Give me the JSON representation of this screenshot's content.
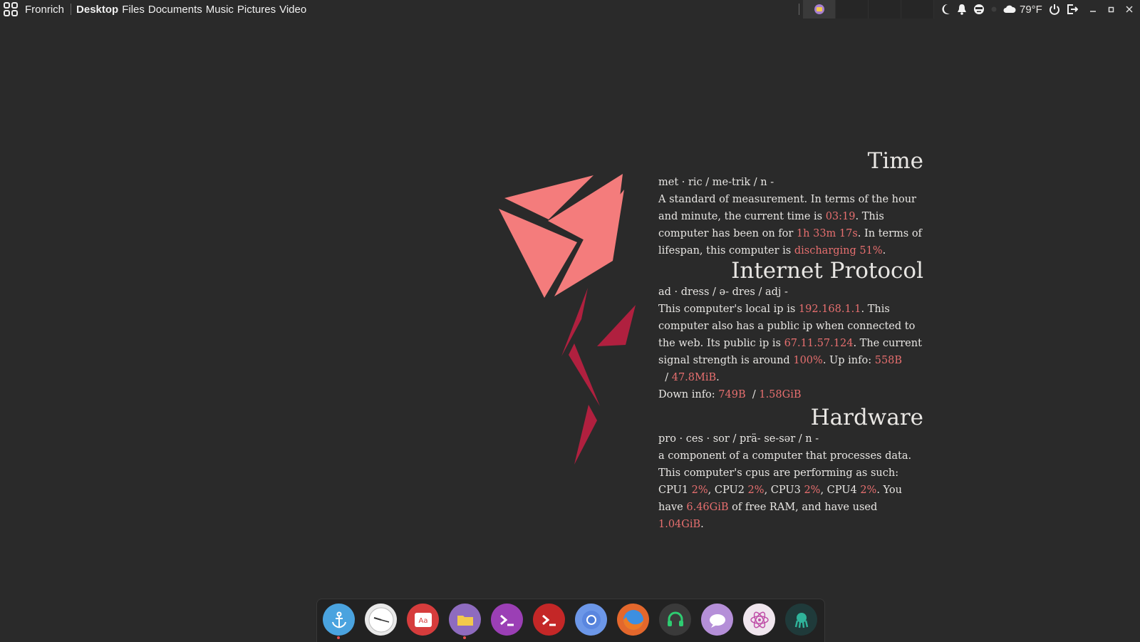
{
  "topbar": {
    "username": "Fronrich",
    "places": [
      "Desktop",
      "Files",
      "Documents",
      "Music",
      "Pictures",
      "Video"
    ],
    "weather": "79°F",
    "tray_icons": [
      "moon-icon",
      "bell-icon",
      "face-icon",
      "cloud-icon",
      "power-icon",
      "logout-icon"
    ],
    "window_controls": [
      "minimize",
      "maximize",
      "close"
    ]
  },
  "sections": {
    "time": {
      "title": "Time",
      "pron": "met · ric /  me-trik / n -",
      "p1": "A standard of measurement. In terms of the hour and minute, the current time is ",
      "time": "03:19",
      "p2": ". This computer has been on for ",
      "uptime": "1h 33m 17s",
      "p3": ". In terms of lifespan, this computer is ",
      "battery": "discharging 51%",
      "p4": "."
    },
    "ip": {
      "title": "Internet Protocol",
      "pron": "ad · dress / ə- dres / adj -",
      "p1": "This computer's local ip is ",
      "local_ip": "192.168.1.1",
      "p2": ". This computer also has a public ip when connected to the web. Its public ip is ",
      "public_ip": "67.11.57.124",
      "p3": ". The current signal strength is around ",
      "signal": "100%",
      "p4": ". Up info: ",
      "up_now": "558B",
      "p5": "  / ",
      "up_total": "47.8MiB",
      "p6": ".",
      "p7": "Down info: ",
      "down_now": "749B",
      "p8": "  / ",
      "down_total": "1.58GiB"
    },
    "hw": {
      "title": "Hardware",
      "pron": "pro · ces · sor /  prä- se-sər / n -",
      "p1": "a component of a computer that processes data. This computer's cpus are performing as such: CPU1 ",
      "cpu1": "2%",
      "p2": ", CPU2 ",
      "cpu2": "2%",
      "p3": ", CPU3 ",
      "cpu3": "2%",
      "p4": ", CPU4 ",
      "cpu4": "2%",
      "p5": ". You have ",
      "free_ram": "6.46GiB",
      "p6": " of free RAM, and have used ",
      "used_ram": "1.04GiB",
      "p7": "."
    }
  },
  "colors": {
    "background": "#2a2a2a",
    "highlight": "#e76f6f",
    "logo_light": "#f47c7c",
    "logo_dark": "#b0203f"
  },
  "dock": {
    "items": [
      "anchor-app",
      "clock-app",
      "dictionary-app",
      "files-app",
      "terminal-app",
      "terminal-red-app",
      "chromium-app",
      "firefox-app",
      "headset-app",
      "chat-app",
      "atom-app",
      "kraken-app"
    ]
  }
}
